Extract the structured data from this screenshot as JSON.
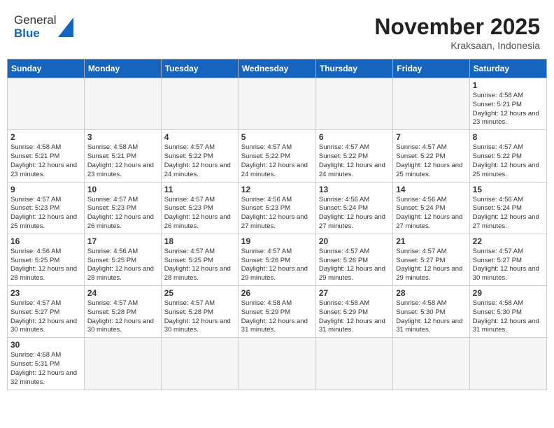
{
  "header": {
    "logo_general": "General",
    "logo_blue": "Blue",
    "month_year": "November 2025",
    "location": "Kraksaan, Indonesia"
  },
  "weekdays": [
    "Sunday",
    "Monday",
    "Tuesday",
    "Wednesday",
    "Thursday",
    "Friday",
    "Saturday"
  ],
  "weeks": [
    [
      {
        "day": "",
        "info": ""
      },
      {
        "day": "",
        "info": ""
      },
      {
        "day": "",
        "info": ""
      },
      {
        "day": "",
        "info": ""
      },
      {
        "day": "",
        "info": ""
      },
      {
        "day": "",
        "info": ""
      },
      {
        "day": "1",
        "info": "Sunrise: 4:58 AM\nSunset: 5:21 PM\nDaylight: 12 hours\nand 23 minutes."
      }
    ],
    [
      {
        "day": "2",
        "info": "Sunrise: 4:58 AM\nSunset: 5:21 PM\nDaylight: 12 hours\nand 23 minutes."
      },
      {
        "day": "3",
        "info": "Sunrise: 4:58 AM\nSunset: 5:21 PM\nDaylight: 12 hours\nand 23 minutes."
      },
      {
        "day": "4",
        "info": "Sunrise: 4:57 AM\nSunset: 5:22 PM\nDaylight: 12 hours\nand 24 minutes."
      },
      {
        "day": "5",
        "info": "Sunrise: 4:57 AM\nSunset: 5:22 PM\nDaylight: 12 hours\nand 24 minutes."
      },
      {
        "day": "6",
        "info": "Sunrise: 4:57 AM\nSunset: 5:22 PM\nDaylight: 12 hours\nand 24 minutes."
      },
      {
        "day": "7",
        "info": "Sunrise: 4:57 AM\nSunset: 5:22 PM\nDaylight: 12 hours\nand 25 minutes."
      },
      {
        "day": "8",
        "info": "Sunrise: 4:57 AM\nSunset: 5:22 PM\nDaylight: 12 hours\nand 25 minutes."
      }
    ],
    [
      {
        "day": "9",
        "info": "Sunrise: 4:57 AM\nSunset: 5:23 PM\nDaylight: 12 hours\nand 25 minutes."
      },
      {
        "day": "10",
        "info": "Sunrise: 4:57 AM\nSunset: 5:23 PM\nDaylight: 12 hours\nand 26 minutes."
      },
      {
        "day": "11",
        "info": "Sunrise: 4:57 AM\nSunset: 5:23 PM\nDaylight: 12 hours\nand 26 minutes."
      },
      {
        "day": "12",
        "info": "Sunrise: 4:56 AM\nSunset: 5:23 PM\nDaylight: 12 hours\nand 27 minutes."
      },
      {
        "day": "13",
        "info": "Sunrise: 4:56 AM\nSunset: 5:24 PM\nDaylight: 12 hours\nand 27 minutes."
      },
      {
        "day": "14",
        "info": "Sunrise: 4:56 AM\nSunset: 5:24 PM\nDaylight: 12 hours\nand 27 minutes."
      },
      {
        "day": "15",
        "info": "Sunrise: 4:56 AM\nSunset: 5:24 PM\nDaylight: 12 hours\nand 27 minutes."
      }
    ],
    [
      {
        "day": "16",
        "info": "Sunrise: 4:56 AM\nSunset: 5:25 PM\nDaylight: 12 hours\nand 28 minutes."
      },
      {
        "day": "17",
        "info": "Sunrise: 4:56 AM\nSunset: 5:25 PM\nDaylight: 12 hours\nand 28 minutes."
      },
      {
        "day": "18",
        "info": "Sunrise: 4:57 AM\nSunset: 5:25 PM\nDaylight: 12 hours\nand 28 minutes."
      },
      {
        "day": "19",
        "info": "Sunrise: 4:57 AM\nSunset: 5:26 PM\nDaylight: 12 hours\nand 29 minutes."
      },
      {
        "day": "20",
        "info": "Sunrise: 4:57 AM\nSunset: 5:26 PM\nDaylight: 12 hours\nand 29 minutes."
      },
      {
        "day": "21",
        "info": "Sunrise: 4:57 AM\nSunset: 5:27 PM\nDaylight: 12 hours\nand 29 minutes."
      },
      {
        "day": "22",
        "info": "Sunrise: 4:57 AM\nSunset: 5:27 PM\nDaylight: 12 hours\nand 30 minutes."
      }
    ],
    [
      {
        "day": "23",
        "info": "Sunrise: 4:57 AM\nSunset: 5:27 PM\nDaylight: 12 hours\nand 30 minutes."
      },
      {
        "day": "24",
        "info": "Sunrise: 4:57 AM\nSunset: 5:28 PM\nDaylight: 12 hours\nand 30 minutes."
      },
      {
        "day": "25",
        "info": "Sunrise: 4:57 AM\nSunset: 5:28 PM\nDaylight: 12 hours\nand 30 minutes."
      },
      {
        "day": "26",
        "info": "Sunrise: 4:58 AM\nSunset: 5:29 PM\nDaylight: 12 hours\nand 31 minutes."
      },
      {
        "day": "27",
        "info": "Sunrise: 4:58 AM\nSunset: 5:29 PM\nDaylight: 12 hours\nand 31 minutes."
      },
      {
        "day": "28",
        "info": "Sunrise: 4:58 AM\nSunset: 5:30 PM\nDaylight: 12 hours\nand 31 minutes."
      },
      {
        "day": "29",
        "info": "Sunrise: 4:58 AM\nSunset: 5:30 PM\nDaylight: 12 hours\nand 31 minutes."
      }
    ],
    [
      {
        "day": "30",
        "info": "Sunrise: 4:58 AM\nSunset: 5:31 PM\nDaylight: 12 hours\nand 32 minutes."
      },
      {
        "day": "",
        "info": ""
      },
      {
        "day": "",
        "info": ""
      },
      {
        "day": "",
        "info": ""
      },
      {
        "day": "",
        "info": ""
      },
      {
        "day": "",
        "info": ""
      },
      {
        "day": "",
        "info": ""
      }
    ]
  ]
}
